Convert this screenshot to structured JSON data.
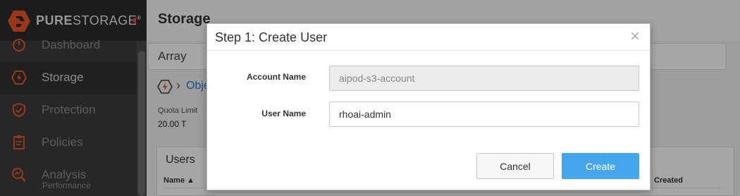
{
  "brand": {
    "name_bold": "PURE",
    "name_thin": "STORAGE",
    "mark": "®"
  },
  "sidebar": {
    "items": [
      {
        "label": "Dashboard",
        "icon": "dashboard-icon"
      },
      {
        "label": "Storage",
        "icon": "storage-icon",
        "active": true
      },
      {
        "label": "Protection",
        "icon": "shield-icon"
      },
      {
        "label": "Policies",
        "icon": "clipboard-icon"
      },
      {
        "label": "Analysis",
        "sub": "Performance",
        "icon": "analysis-icon"
      }
    ]
  },
  "main": {
    "title": "Storage",
    "array_label": "Array",
    "breadcrumb_link": "Obje",
    "quota_label": "Quota Limit",
    "quota_value": "20.00 T",
    "users_title": "Users",
    "col_name": "Name",
    "col_created": "Created"
  },
  "modal": {
    "title": "Step 1: Create User",
    "close_glyph": "×",
    "account_label": "Account Name",
    "account_value": "aipod-s3-account",
    "user_label": "User Name",
    "user_value": "rhoai-admin",
    "cancel_label": "Cancel",
    "create_label": "Create"
  },
  "colors": {
    "brand_orange": "#e8562a",
    "primary_button": "#46a6ec",
    "link": "#2d7bc4",
    "sidebar_bg": "#3c3c3c"
  }
}
